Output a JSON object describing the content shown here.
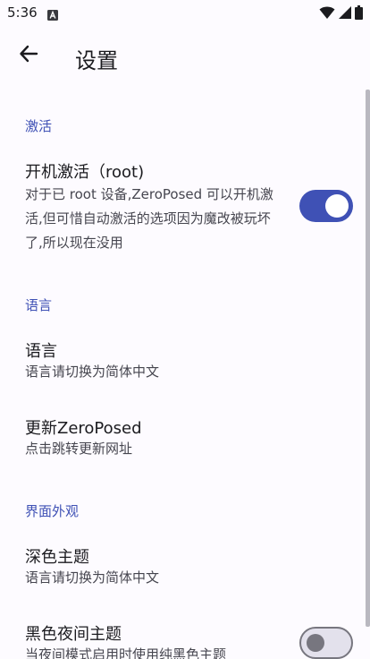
{
  "status_bar": {
    "time": "5:36",
    "app_icon": "app-notification-icon",
    "wifi_icon": "wifi-icon",
    "signal_icon": "cellular-signal-icon",
    "battery_icon": "battery-icon"
  },
  "app_bar": {
    "back_icon": "arrow-back-icon",
    "title": "设置"
  },
  "sections": {
    "activation": {
      "header": "激活",
      "boot_activation": {
        "title": "开机激活（root)",
        "summary": "对于已 root 设备,ZeroPosed 可以开机激活,但可惜自动激活的选项因为魔改被玩坏了,所以现在没用",
        "enabled": true
      }
    },
    "language": {
      "header": "语言",
      "language": {
        "title": "语言",
        "summary": "语言请切换为简体中文"
      },
      "update": {
        "title": "更新ZeroPosed",
        "summary": "点击跳转更新网址"
      }
    },
    "appearance": {
      "header": "界面外观",
      "dark_theme": {
        "title": "深色主题",
        "summary": "语言请切换为简体中文"
      },
      "black_night_theme": {
        "title": "黑色夜间主题",
        "summary": "当夜间模式启用时使用纯黑色主题",
        "enabled": false
      }
    }
  },
  "colors": {
    "accent": "#3f51b5",
    "background": "#fdfbff",
    "text_primary": "#1b1b1f",
    "text_secondary": "#46464f"
  }
}
